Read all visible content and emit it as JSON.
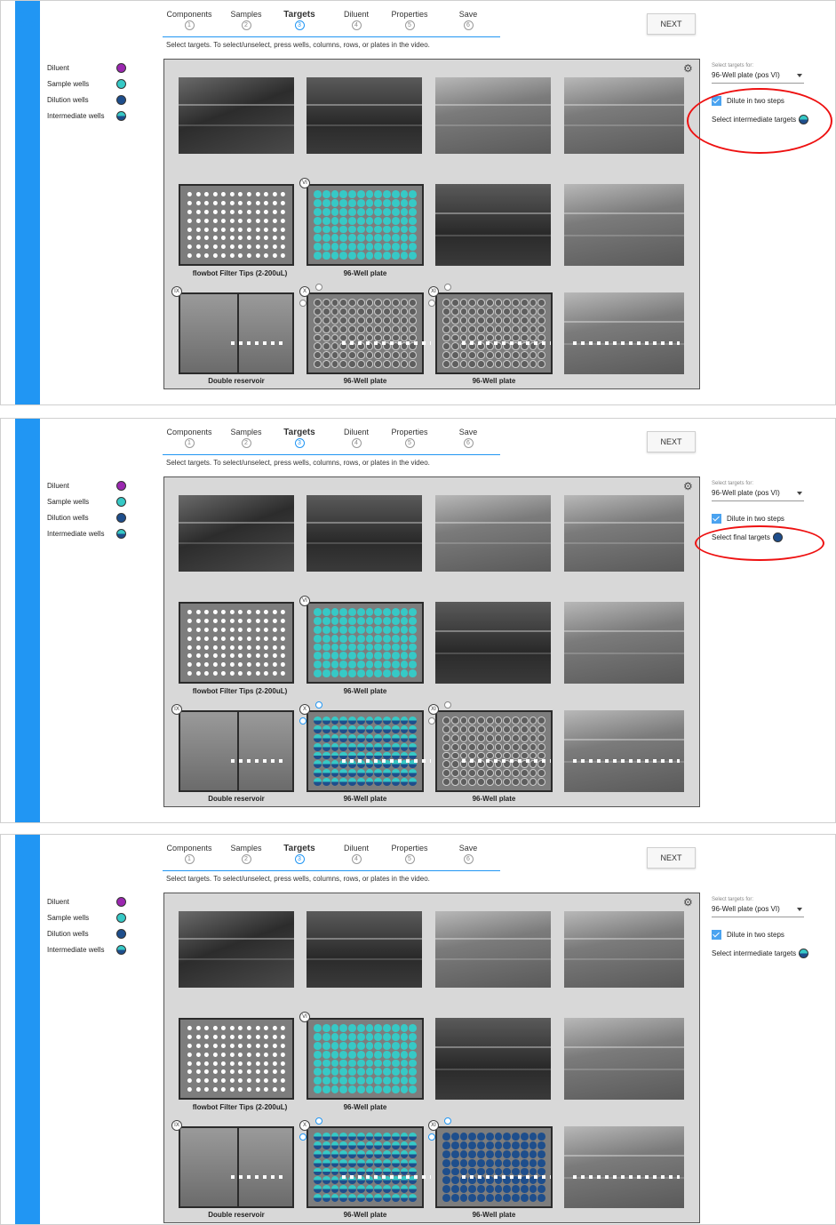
{
  "colors": {
    "diluent": "#9b27b0",
    "sample": "#36c9c6",
    "dilution": "#1e4e8c",
    "intermediate": "#36c9c6",
    "accent": "#2196f3"
  },
  "steps": [
    {
      "label": "Components",
      "num": "1"
    },
    {
      "label": "Samples",
      "num": "2"
    },
    {
      "label": "Targets",
      "num": "3"
    },
    {
      "label": "Diluent",
      "num": "4"
    },
    {
      "label": "Properties",
      "num": "5"
    },
    {
      "label": "Save",
      "num": "6"
    }
  ],
  "instruction": "Select targets. To select/unselect, press wells, columns, rows, or plates in the video.",
  "next_label": "NEXT",
  "legend": [
    {
      "label": "Diluent",
      "icon": "purple-dot-icon"
    },
    {
      "label": "Sample wells",
      "icon": "teal-dot-icon"
    },
    {
      "label": "Dilution wells",
      "icon": "navy-dot-icon"
    },
    {
      "label": "Intermediate wells",
      "icon": "half-teal-navy-dot-icon"
    }
  ],
  "plates": {
    "tips_label": "flowbot Filter Tips (2-200uL)",
    "plate_vi_label": "96-Well plate",
    "reservoir_label": "Double reservoir",
    "plate_x_label": "96-Well plate",
    "plate_xi_label": "96-Well plate",
    "badge_vi": "VI",
    "badge_ix": "IX",
    "badge_x": "X",
    "badge_xi": "XI"
  },
  "side": {
    "select_caption": "Select targets for:",
    "select_value": "96-Well plate (pos VI)",
    "dilute_two_steps": "Dilute in two steps"
  },
  "panels": [
    {
      "target_label": "Select intermediate targets"
    },
    {
      "target_label": "Select final targets"
    },
    {
      "target_label": "Select intermediate targets"
    }
  ]
}
